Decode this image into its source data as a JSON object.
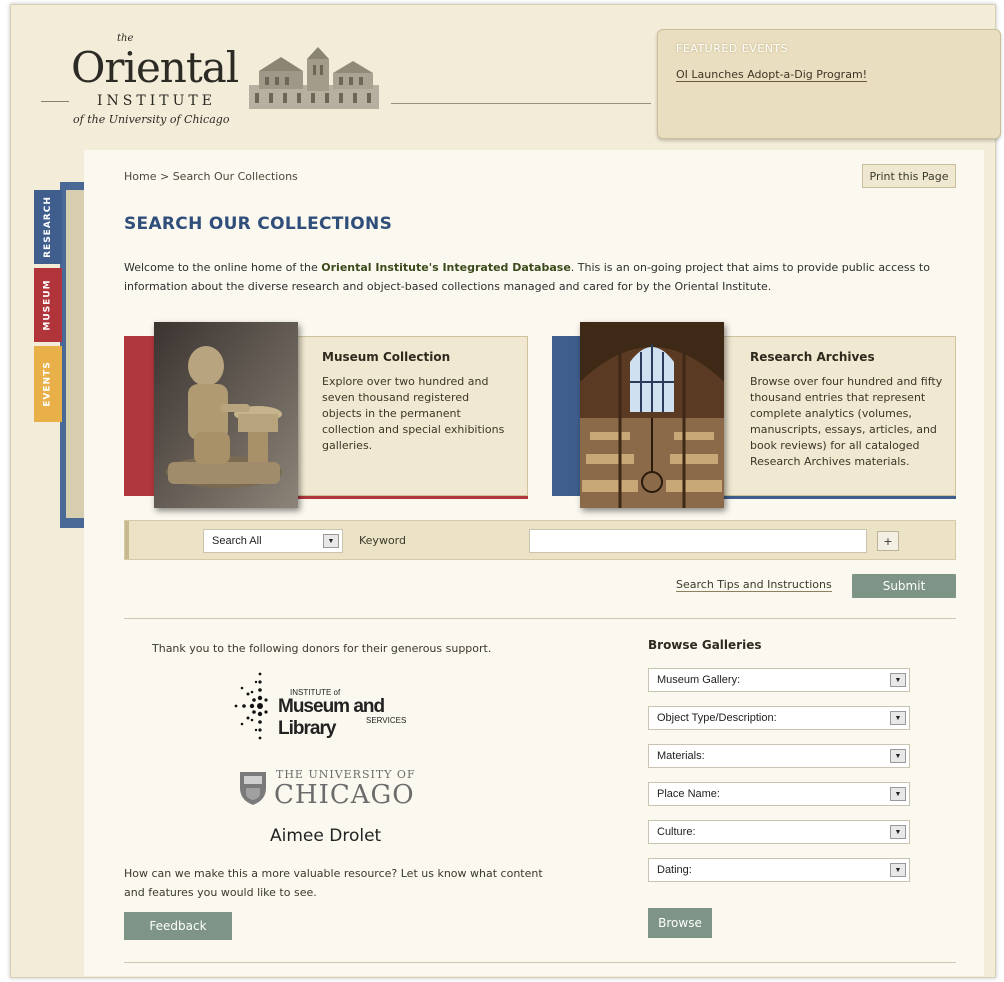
{
  "header": {
    "logo_the": "the",
    "logo_oriental": "Oriental",
    "logo_institute": "INSTITUTE",
    "logo_university": "of the University of Chicago"
  },
  "featured": {
    "title": "FEATURED EVENTS",
    "link": "OI Launches Adopt-a-Dig Program!"
  },
  "side_tabs": [
    "RESEARCH",
    "MUSEUM",
    "EVENTS"
  ],
  "breadcrumb": "Home > Search Our Collections",
  "print_button": "Print this Page",
  "page_title": "SEARCH OUR COLLECTIONS",
  "intro": {
    "before": "Welcome to the online home of the ",
    "highlight": "Oriental Institute's Integrated Database",
    "after": ". This is an on-going project that aims to provide public access to information about the diverse research and object-based collections managed and cared for by the Oriental Institute."
  },
  "cards": {
    "museum": {
      "title": "Museum Collection",
      "description": "Explore over two hundred and seven thousand registered objects in the permanent collection and special exhibitions galleries."
    },
    "archives": {
      "title": "Research Archives",
      "description": "Browse over four hundred and fifty thousand entries that represent complete analytics (volumes, manuscripts, essays, articles, and book reviews) for all cataloged Research Archives materials."
    }
  },
  "search": {
    "scope_selected": "Search All",
    "keyword_label": "Keyword",
    "keyword_value": "",
    "plus_label": "+",
    "tips_link": "Search Tips and Instructions",
    "submit_label": "Submit"
  },
  "donors": {
    "thanks_text": "Thank you to the following donors for their generous support.",
    "imls_line1": "INSTITUTE of",
    "imls_line2": "Museum and Library",
    "imls_line3": "SERVICES",
    "uchicago_line1": "THE UNIVERSITY OF",
    "uchicago_line2": "CHICAGO",
    "donor_name": "Aimee Drolet"
  },
  "feedback": {
    "text": "How can we make this a more valuable resource? Let us know what content and features you would like to see.",
    "button": "Feedback"
  },
  "browse": {
    "title": "Browse Galleries",
    "selects": [
      "Museum Gallery:",
      "Object Type/Description:",
      "Materials:",
      "Place Name:",
      "Culture:",
      "Dating:"
    ],
    "button": "Browse"
  },
  "colors": {
    "research_blue": "#3f5e8d",
    "museum_red": "#b0343a",
    "events_gold": "#e9b04a",
    "button_green": "#7d9486",
    "title_blue": "#2f4e7a"
  }
}
